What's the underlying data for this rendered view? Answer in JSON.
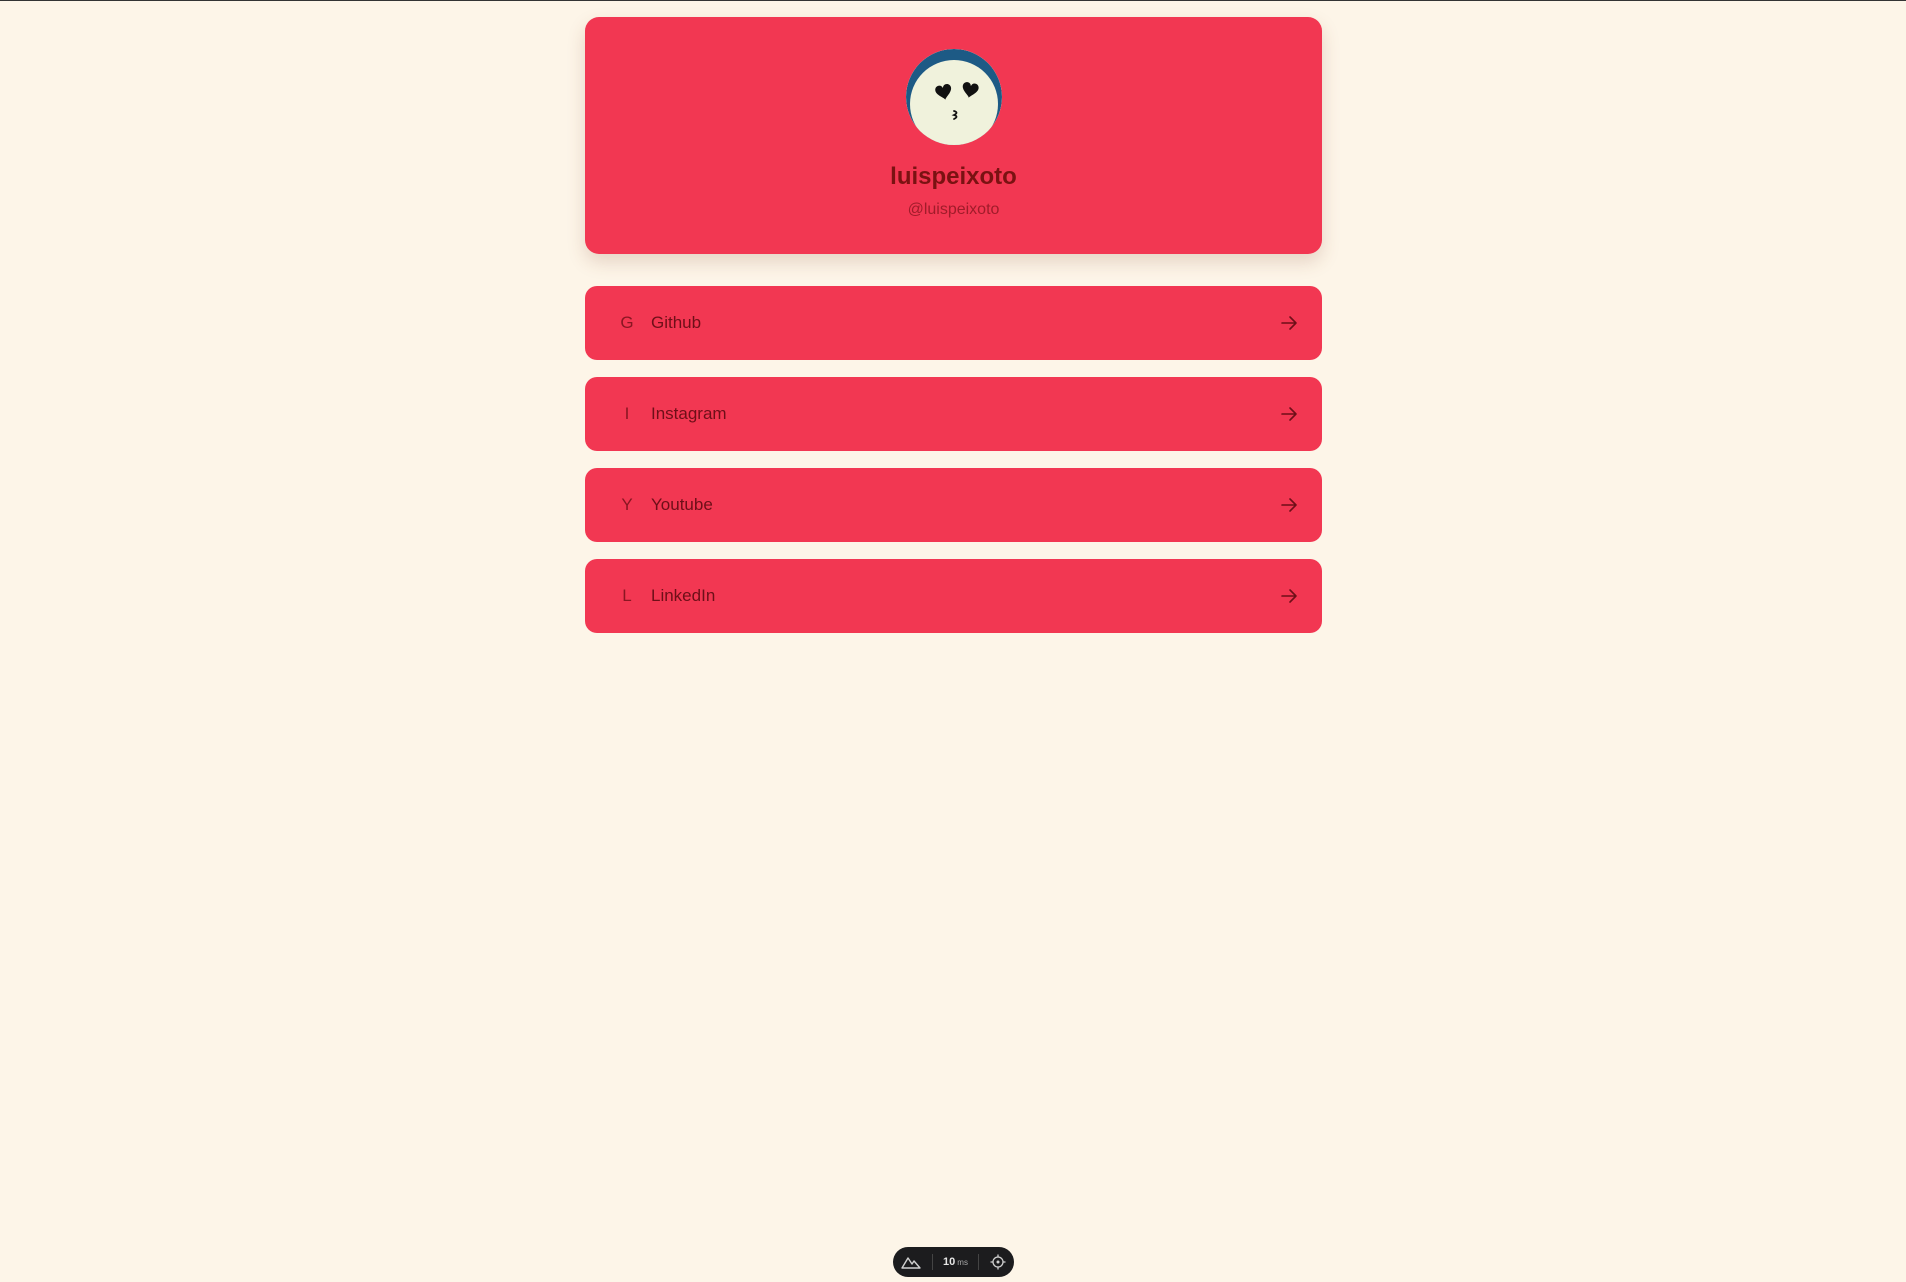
{
  "profile": {
    "name": "luispeixoto",
    "handle": "@luispeixoto",
    "avatar_icon": "kissing-face-heart-eyes-icon"
  },
  "links": [
    {
      "letter": "G",
      "label": "Github",
      "icon": "arrow-right-icon"
    },
    {
      "letter": "I",
      "label": "Instagram",
      "icon": "arrow-right-icon"
    },
    {
      "letter": "Y",
      "label": "Youtube",
      "icon": "arrow-right-icon"
    },
    {
      "letter": "L",
      "label": "LinkedIn",
      "icon": "arrow-right-icon"
    }
  ],
  "toolbar": {
    "timing_value": "10",
    "timing_unit": "ms",
    "left_icon": "mountain-logo-icon",
    "right_icon": "target-icon"
  },
  "colors": {
    "background": "#fdf5e8",
    "card": "#f23752",
    "text_dark": "#6e0f18",
    "avatar_ring": "#1d5a85",
    "avatar_face": "#f0f2dc"
  }
}
